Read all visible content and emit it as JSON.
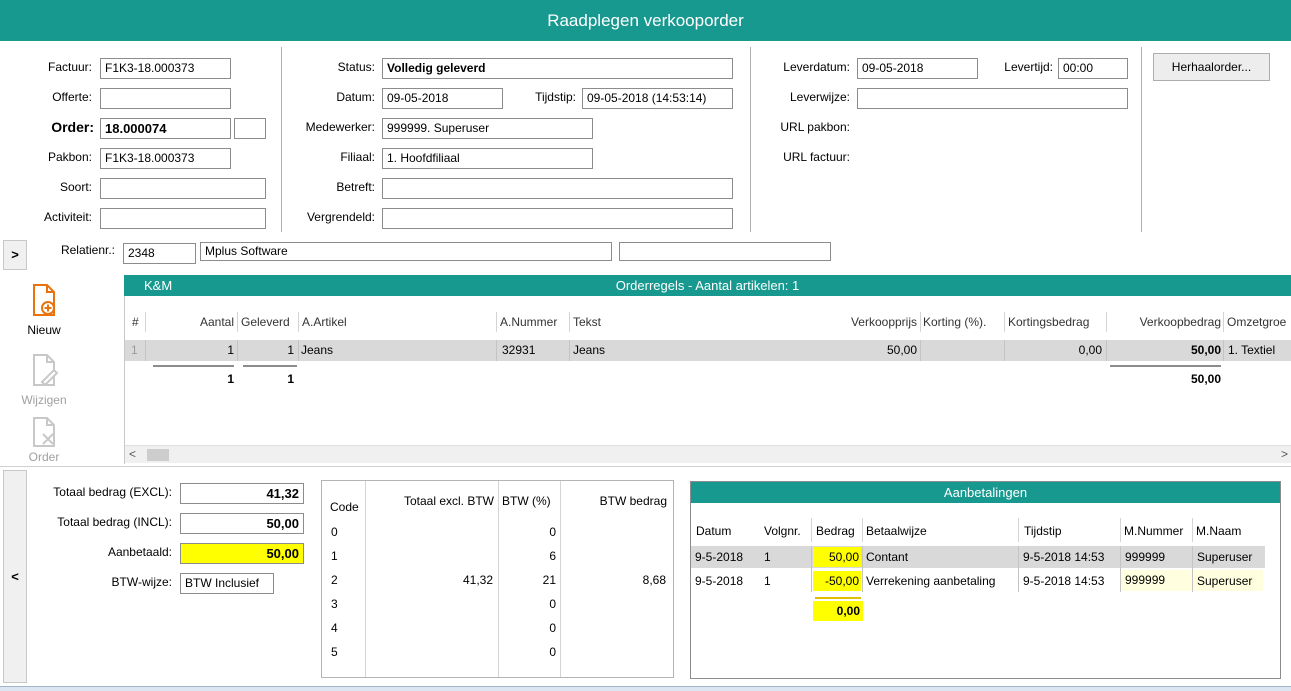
{
  "window": {
    "title": "Raadplegen verkooporder"
  },
  "header_left": {
    "factuur_label": "Factuur:",
    "factuur_value": "F1K3-18.000373",
    "offerte_label": "Offerte:",
    "offerte_value": "",
    "order_label": "Order:",
    "order_value": "18.000074",
    "order_suffix": "",
    "pakbon_label": "Pakbon:",
    "pakbon_value": "F1K3-18.000373",
    "soort_label": "Soort:",
    "soort_value": "",
    "activiteit_label": "Activiteit:",
    "activiteit_value": ""
  },
  "header_mid": {
    "status_label": "Status:",
    "status_value": "Volledig geleverd",
    "datum_label": "Datum:",
    "datum_value": "09-05-2018",
    "tijdstip_label": "Tijdstip:",
    "tijdstip_value": "09-05-2018 (14:53:14)",
    "medewerker_label": "Medewerker:",
    "medewerker_value": "999999. Superuser",
    "filiaal_label": "Filiaal:",
    "filiaal_value": "1. Hoofdfiliaal",
    "betreft_label": "Betreft:",
    "betreft_value": "",
    "vergrendeld_label": "Vergrendeld:",
    "vergrendeld_value": ""
  },
  "header_right": {
    "leverdatum_label": "Leverdatum:",
    "leverdatum_value": "09-05-2018",
    "levertijd_label": "Levertijd:",
    "levertijd_value": "00:00",
    "leverwijze_label": "Leverwijze:",
    "leverwijze_value": "",
    "url_pakbon_label": "URL pakbon:",
    "url_factuur_label": "URL factuur:",
    "herhaalorder_label": "Herhaalorder..."
  },
  "relatie": {
    "expand_label": ">",
    "label": "Relatienr.:",
    "nummer": "2348",
    "naam": "Mplus Software",
    "extra": ""
  },
  "tools": {
    "nieuw": "Nieuw",
    "wijzigen": "Wijzigen",
    "annuleren": "Order annuleren"
  },
  "orderregels": {
    "tab": "K&M",
    "title": "Orderregels - Aantal artikelen: 1",
    "columns": [
      "#",
      "Aantal",
      "Geleverd",
      "A.Artikel",
      "A.Nummer",
      "Tekst",
      "Verkoopprijs",
      "Korting (%).",
      "Kortingsbedrag",
      "Verkoopbedrag",
      "Omzetgroe"
    ],
    "row": {
      "nr": "1",
      "aantal": "1",
      "geleverd": "1",
      "artikel": "Jeans",
      "nummer": "32931",
      "tekst": "Jeans",
      "verkoopprijs": "50,00",
      "korting": "",
      "kortingsbedrag": "0,00",
      "verkoopbedrag": "50,00",
      "omzetgroep": "1. Textiel"
    },
    "totals": {
      "aantal": "1",
      "geleverd": "1",
      "verkoopbedrag": "50,00"
    },
    "scroll_left": "<",
    "scroll_right": ">"
  },
  "totals": {
    "collapse_label": "<",
    "excl_label": "Totaal bedrag (EXCL):",
    "excl_value": "41,32",
    "incl_label": "Totaal bedrag (INCL):",
    "incl_value": "50,00",
    "aanbetaald_label": "Aanbetaald:",
    "aanbetaald_value": "50,00",
    "btwwijze_label": "BTW-wijze:",
    "btwwijze_value": "BTW Inclusief"
  },
  "btw_table": {
    "columns": [
      "Code",
      "Totaal excl. BTW",
      "BTW (%)",
      "BTW bedrag"
    ],
    "rows": [
      {
        "code": "0",
        "excl": "",
        "pct": "0",
        "bedrag": ""
      },
      {
        "code": "1",
        "excl": "",
        "pct": "6",
        "bedrag": ""
      },
      {
        "code": "2",
        "excl": "41,32",
        "pct": "21",
        "bedrag": "8,68"
      },
      {
        "code": "3",
        "excl": "",
        "pct": "0",
        "bedrag": ""
      },
      {
        "code": "4",
        "excl": "",
        "pct": "0",
        "bedrag": ""
      },
      {
        "code": "5",
        "excl": "",
        "pct": "0",
        "bedrag": ""
      }
    ]
  },
  "aanbetalingen": {
    "title": "Aanbetalingen",
    "columns": [
      "Datum",
      "Volgnr.",
      "Bedrag",
      "Betaalwijze",
      "Tijdstip",
      "M.Nummer",
      "M.Naam"
    ],
    "rows": [
      {
        "datum": "9-5-2018",
        "volgnr": "1",
        "bedrag": "50,00",
        "betaalwijze": "Contant",
        "tijdstip": "9-5-2018 14:53",
        "mnummer": "999999",
        "mnaam": "Superuser"
      },
      {
        "datum": "9-5-2018",
        "volgnr": "1",
        "bedrag": "-50,00",
        "betaalwijze": "Verrekening aanbetaling",
        "tijdstip": "9-5-2018 14:53",
        "mnummer": "999999",
        "mnaam": "Superuser"
      }
    ],
    "total": "0,00"
  },
  "colors": {
    "teal": "#17998f",
    "highlight": "#ffff00",
    "selected_row": "#d9d9d9"
  }
}
